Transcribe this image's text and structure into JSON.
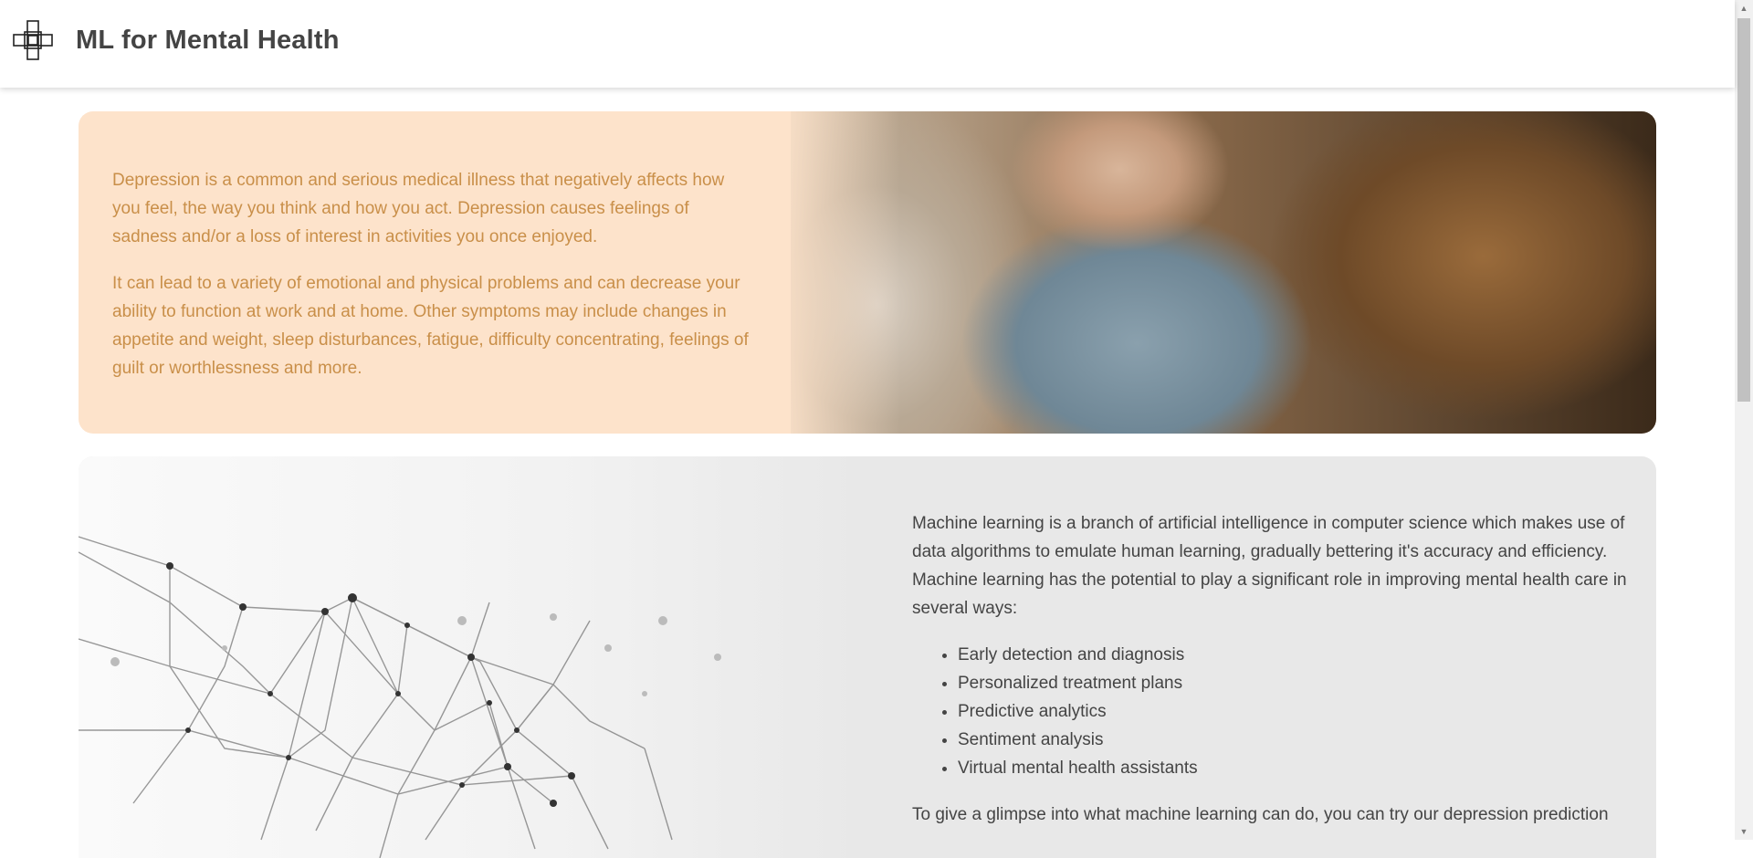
{
  "header": {
    "title": "ML for Mental Health",
    "logo_icon": "medical-cross-icon"
  },
  "depression_card": {
    "paragraphs": [
      "Depression is a common and serious medical illness that negatively affects how you feel, the way you think and how you act. Depression causes feelings of sadness and/or a loss of interest in activities you once enjoyed.",
      "It can lead to a variety of emotional and physical problems and can decrease your ability to function at work and at home. Other symptoms may include changes in appetite and weight, sleep disturbances, fatigue, difficulty concentrating, feelings of guilt or worthlessness and more."
    ],
    "text_color": "#c98f49",
    "background": "#fde3cb"
  },
  "ml_card": {
    "intro": "Machine learning is a branch of artificial intelligence in computer science which makes use of data algorithms to emulate human learning, gradually bettering it's accuracy and efficiency. Machine learning has the potential to play a significant role in improving mental health care in several ways:",
    "items": [
      "Early detection and diagnosis",
      "Personalized treatment plans",
      "Predictive analytics",
      "Sentiment analysis",
      "Virtual mental health assistants"
    ],
    "outro": "To give a glimpse into what machine learning can do, you can try our depression prediction",
    "background": "#e8e8e8"
  }
}
